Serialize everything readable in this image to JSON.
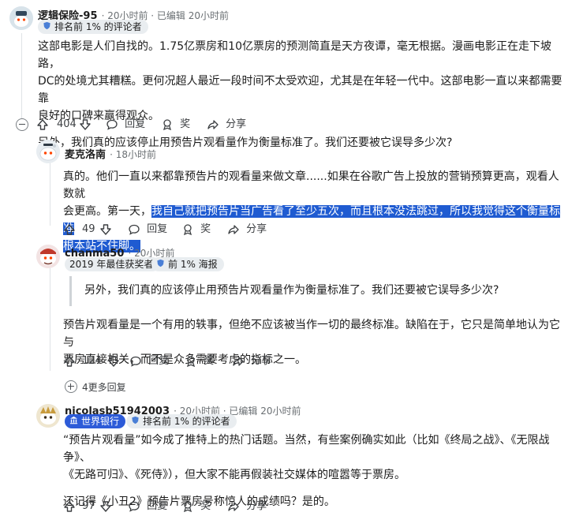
{
  "comments": [
    {
      "username": "逻辑保险-95",
      "meta": "· 20小时前 · 已编辑 20小时前",
      "flairs": [
        {
          "icon": "shield-icon",
          "text": "排名前 1% 的评论者"
        }
      ],
      "paragraphs": [
        "这部电影是人们自找的。1.75亿票房和10亿票房的预测简直是天方夜谭，毫无根据。漫画电影正在走下坡路，",
        "DC的处境尤其糟糕。更何况超人最近一段时间不太受欢迎，尤其是在年轻一代中。这部电影一直以来都需要靠",
        "良好的口碑来赢得观众。",
        "另外，我们真的应该停止用预告片观看量作为衡量标准了。我们还要被它误导多少次?"
      ],
      "votes": "404",
      "reply": "回复",
      "award": "奖",
      "share": "分享"
    },
    {
      "username": "麦克洛南",
      "meta": "· 18小时前",
      "line1": "真的。他们一直以来都靠预告片的观看量来做文章......如果在谷歌广告上投放的营销预算更高，观看人数就",
      "line2_plain": "会更高。第一天，",
      "line2_hl": "我自己就把预告片当广告看了至少五次，而且根本没法跳过，所以我觉得这个衡量标准",
      "line3_hl": "根本站不住脚。",
      "votes": "49",
      "reply": "回复",
      "award": "奖",
      "share": "分享"
    },
    {
      "username": "chanma50",
      "meta": "· 20小时前",
      "flairs": [
        {
          "icon": "",
          "text": "2019 年最佳获奖者"
        },
        {
          "icon": "shield-icon",
          "text": "前 1% 海报"
        }
      ],
      "quote": "另外，我们真的应该停止用预告片观看量作为衡量标准了。我们还要被它误导多少次?",
      "paragraphs": [
        "预告片观看量是一个有用的轶事，但绝不应该被当作一切的最终标准。缺陷在于，它只是简单地认为它与",
        "票房直接相关，而不是众多需要考虑的指标之一。"
      ],
      "votes": "124",
      "reply": "回复",
      "award": "奖",
      "share": "分享"
    },
    {
      "more_replies": "4更多回复"
    },
    {
      "username": "nicolasb51942003",
      "meta": "· 20小时前 · 已编辑 20小时前",
      "flairs": [
        {
          "icon": "bank-icon",
          "text": "世界银行"
        },
        {
          "icon": "shield-icon",
          "text": "排名前 1% 的评论者"
        }
      ],
      "paragraphs": [
        "“预告片观看量”如今成了推特上的热门话题。当然，有些案例确实如此（比如《终局之战》、《无限战争》、",
        "《无路可归》、《死侍》），但大家不能再假装社交媒体的喧嚣等于票房。",
        "还记得《小丑2》预告片票房号称惊人的成绩吗？是的。"
      ],
      "votes": "97",
      "reply": "回复",
      "award": "奖",
      "share": "分享"
    }
  ],
  "colors": {
    "highlight": "#1f5bd1",
    "bank_badge": "#2d5bd8"
  }
}
